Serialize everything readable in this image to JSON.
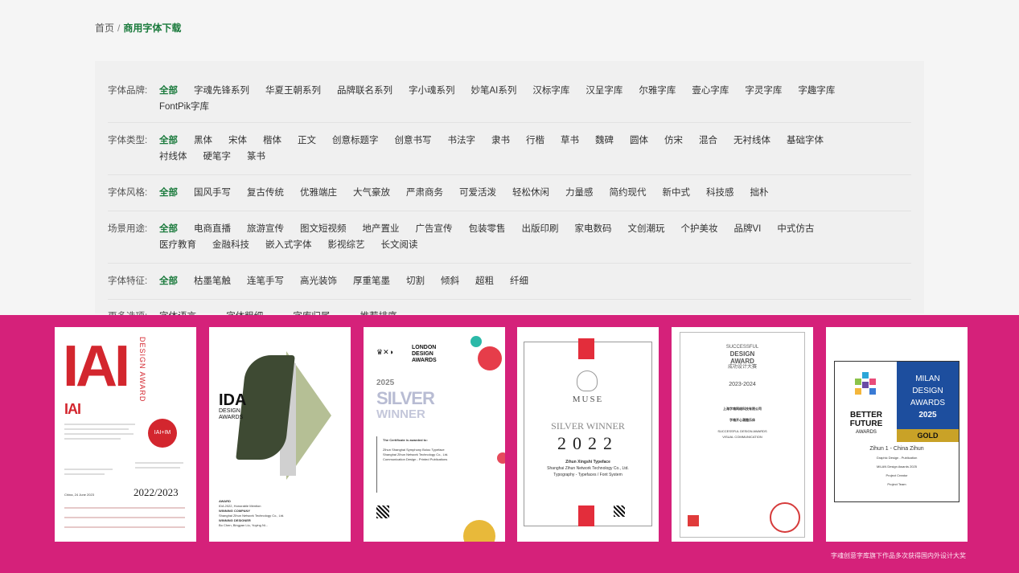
{
  "breadcrumb": {
    "home": "首页",
    "separator": "/",
    "current": "商用字体下载"
  },
  "filters": [
    {
      "label": "字体品牌:",
      "options": [
        "全部",
        "字魂先锋系列",
        "华夏王朝系列",
        "品牌联名系列",
        "字小魂系列",
        "妙笔AI系列",
        "汉标字库",
        "汉呈字库",
        "尔雅字库",
        "壹心字库",
        "字灵字库",
        "字趣字库",
        "FontPik字库"
      ]
    },
    {
      "label": "字体类型:",
      "options": [
        "全部",
        "黑体",
        "宋体",
        "楷体",
        "正文",
        "创意标题字",
        "创意书写",
        "书法字",
        "隶书",
        "行楷",
        "草书",
        "魏碑",
        "圆体",
        "仿宋",
        "混合",
        "无衬线体",
        "基础字体",
        "衬线体",
        "硬笔字",
        "篆书"
      ]
    },
    {
      "label": "字体风格:",
      "options": [
        "全部",
        "国风手写",
        "复古传统",
        "优雅端庄",
        "大气豪放",
        "严肃商务",
        "可爱活泼",
        "轻松休闲",
        "力量感",
        "简约现代",
        "新中式",
        "科技感",
        "拙朴"
      ]
    },
    {
      "label": "场景用途:",
      "options": [
        "全部",
        "电商直播",
        "旅游宣传",
        "图文短视频",
        "地产置业",
        "广告宣传",
        "包装零售",
        "出版印刷",
        "家电数码",
        "文创潮玩",
        "个护美妆",
        "品牌VI",
        "中式仿古",
        "医疗教育",
        "金融科技",
        "嵌入式字体",
        "影视综艺",
        "长文阅读"
      ]
    },
    {
      "label": "字体特征:",
      "options": [
        "全部",
        "枯墨笔触",
        "连笔手写",
        "高光装饰",
        "厚重笔墨",
        "切割",
        "倾斜",
        "超粗",
        "纤细"
      ]
    }
  ],
  "more_options": {
    "label": "更多选项:",
    "dropdowns": [
      "字体语言",
      "字体粗细",
      "字库归属",
      "推荐排序"
    ]
  },
  "colors": {
    "accent": "#1a7a3c",
    "band": "#d5217a"
  },
  "awards": {
    "caption": "字魂创意字库旗下作品多次获得国内外设计大奖",
    "card1": {
      "logo": "IAI",
      "vertical": "DESIGN AWARD",
      "small_logo": "IAI",
      "badge": "IAI+IM",
      "year": "2022/2023",
      "date": "China, 24 June 2023"
    },
    "card2": {
      "logo": "IDA",
      "sub1": "DESIGN",
      "sub2": "AWARDS",
      "meta1": "AWARD",
      "meta2": "IDA 2022, Honorable Mention",
      "meta3": "WINNING COMPANY",
      "meta4": "Shanghai Zihun Network Technology Co., Ltd.",
      "meta5": "WINNING DESIGNER",
      "meta6": "Bo Chen, Bingyan Liu, Yuying Ni..."
    },
    "card3": {
      "org1": "LONDON",
      "org2": "DESIGN",
      "org3": "AWARDS",
      "year": "2025",
      "title1": "SILVER",
      "title2": "WINNER",
      "cert": "The Certificate is awarded to:",
      "cert2": "Zihun Shanghai Symphony Boiou Typeface",
      "cert3": "Shanghai Zihun Network Technology Co., Ltd.",
      "cert4": "Communication Design - Printed Publications"
    },
    "card4": {
      "brand": "MUSE",
      "title": "SILVER WINNER",
      "year": "2022",
      "desc1": "Zihun Xingshi Typeface",
      "desc2": "Shanghai Zihun Network Technology Co., Ltd.",
      "desc3": "Typography - Typefaces / Font System"
    },
    "card5": {
      "logo1": "SUCCESSFUL",
      "logo2": "DESIGN",
      "logo3": "AWARD",
      "logo4": "成功设计大赛",
      "period": "2023-2024",
      "line1": "上海字魂网络科技有限公司",
      "line2": "字魂开心潮趣乐体",
      "line3": "SUCCESSFUL DESIGN AWARDS",
      "line4": "VISUAL COMMUNICATION"
    },
    "card6": {
      "brand1": "BETTER",
      "brand2": "FUTURE",
      "brand3": "AWARDS",
      "right1": "MILAN",
      "right2": "DESIGN",
      "right3": "AWARDS",
      "right4": "2025",
      "medal": "GOLD",
      "info1": "Zihun 1 - China Zihun",
      "info2": "Graphic Design - Publication",
      "info3": "MILAN Design Awards 2025",
      "info4": "Project Creator",
      "info5": "Project Team"
    }
  }
}
